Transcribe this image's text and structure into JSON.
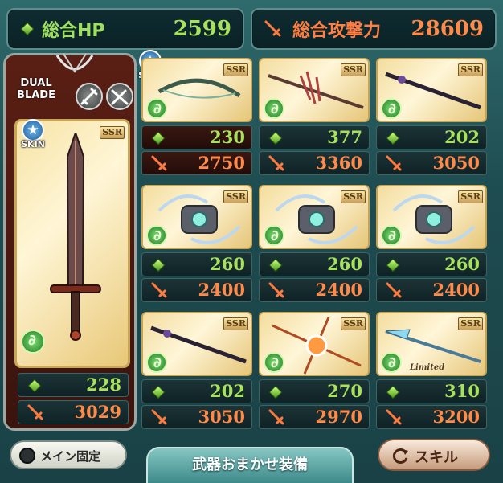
{
  "header": {
    "hp_label": "総合HP",
    "hp_value": "2599",
    "atk_label": "総合攻撃力",
    "atk_value": "28609"
  },
  "main_weapon": {
    "proficiency_label_line1": "DUAL",
    "proficiency_label_line2": "BLADE",
    "skin_label": "SKIN",
    "rarity": "SSR",
    "hp": "228",
    "atk": "3029",
    "weapon_icon": "greatsword-icon",
    "element_icon": "wind-element-icon"
  },
  "top_skin_label": "SKIN",
  "sub_weapons": [
    {
      "rarity": "SSR",
      "hp": "230",
      "atk": "2750",
      "icon": "bow-icon",
      "highlight": true
    },
    {
      "rarity": "SSR",
      "hp": "377",
      "atk": "3360",
      "icon": "spiked-spear-icon"
    },
    {
      "rarity": "SSR",
      "hp": "202",
      "atk": "3050",
      "icon": "dark-staff-icon"
    },
    {
      "rarity": "SSR",
      "hp": "260",
      "atk": "2400",
      "icon": "winged-gauntlet-icon"
    },
    {
      "rarity": "SSR",
      "hp": "260",
      "atk": "2400",
      "icon": "winged-gauntlet-icon"
    },
    {
      "rarity": "SSR",
      "hp": "260",
      "atk": "2400",
      "icon": "winged-gauntlet-icon"
    },
    {
      "rarity": "SSR",
      "hp": "202",
      "atk": "3050",
      "icon": "dark-staff-icon"
    },
    {
      "rarity": "SSR",
      "hp": "270",
      "atk": "2970",
      "icon": "starburst-orb-icon"
    },
    {
      "rarity": "SSR",
      "hp": "310",
      "atk": "3200",
      "icon": "crystal-spear-icon",
      "badge": "Limited"
    }
  ],
  "footer": {
    "lock_label": "メイン固定",
    "auto_equip_label": "武器おまかせ装備",
    "skill_label": "スキル"
  },
  "colors": {
    "hp_green": "#a8e25d",
    "atk_orange": "#ff8a4a",
    "panel_teal": "#2f6a6c"
  }
}
